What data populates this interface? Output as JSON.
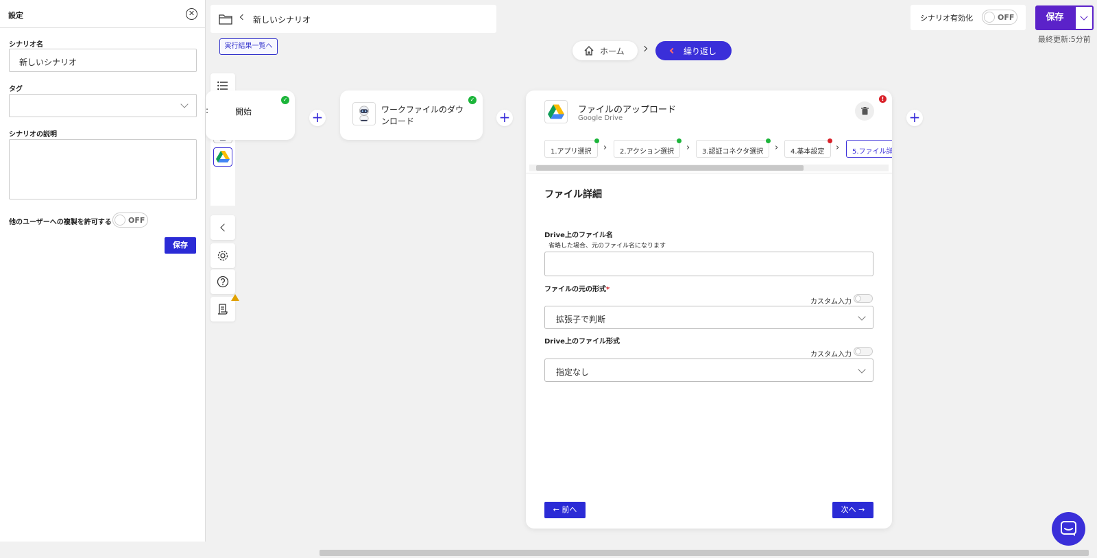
{
  "settings": {
    "title": "設定",
    "scenario_name_label": "シナリオ名",
    "scenario_name_value": "新しいシナリオ",
    "tag_label": "タグ",
    "description_label": "シナリオの説明",
    "allow_copy_label": "他のユーザーへの複製を許可する",
    "allow_copy_state": "OFF",
    "save_label": "保存"
  },
  "header": {
    "scenario_title": "新しいシナリオ",
    "result_link": "実行結果一覧へ",
    "breadcrumb_home": "ホーム",
    "breadcrumb_current": "繰り返し",
    "enable_label": "シナリオ有効化",
    "enable_state": "OFF",
    "save_label": "保存",
    "last_updated": "最終更新:5分前"
  },
  "nodes": {
    "start_label": "開始",
    "download_label": "ワークファイルのダウンロード"
  },
  "action_card": {
    "title": "ファイルのアップロード",
    "subtitle": "Google Drive",
    "steps": [
      "1.アプリ選択",
      "2.アクション選択",
      "3.認証コネクタ選択",
      "4.基本設定",
      "5.ファイル詳"
    ],
    "section_title": "ファイル詳細",
    "file_name_label": "Drive上のファイル名",
    "file_name_hint": "省略した場合、元のファイル名になります",
    "file_name_value": "",
    "source_format_label": "ファイルの元の形式",
    "required_mark": "*",
    "custom_input_label": "カスタム入力",
    "source_format_value": "拡張子で判断",
    "drive_format_label": "Drive上のファイル形式",
    "drive_format_value": "指定なし",
    "prev_label": "← 前へ",
    "next_label": "次へ →"
  },
  "colors": {
    "primary": "#2b2bd6",
    "accent_purple": "#5b22c9",
    "success": "#1cb53a",
    "error": "#d9222a",
    "warning": "#e0a100"
  }
}
